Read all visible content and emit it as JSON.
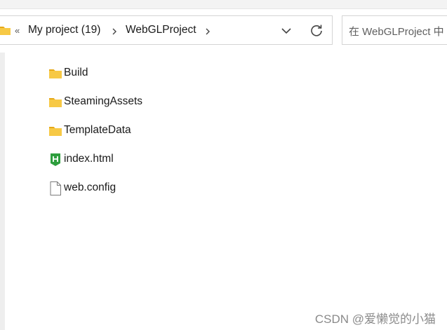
{
  "address_bar": {
    "overflow_glyph": "«",
    "breadcrumbs": [
      {
        "label": "My project (19)"
      },
      {
        "label": "WebGLProject"
      }
    ]
  },
  "search": {
    "placeholder": "在 WebGLProject 中"
  },
  "files": [
    {
      "name": "Build",
      "icon": "folder-icon"
    },
    {
      "name": "SteamingAssets",
      "icon": "folder-icon"
    },
    {
      "name": "TemplateData",
      "icon": "folder-icon"
    },
    {
      "name": "index.html",
      "icon": "html-file-icon"
    },
    {
      "name": "web.config",
      "icon": "document-icon"
    }
  ],
  "watermark": "CSDN @爱懒觉的小猫",
  "colors": {
    "folder": "#f7c945",
    "folder_tab": "#e6a817",
    "html_icon": "#2e9e3e"
  }
}
